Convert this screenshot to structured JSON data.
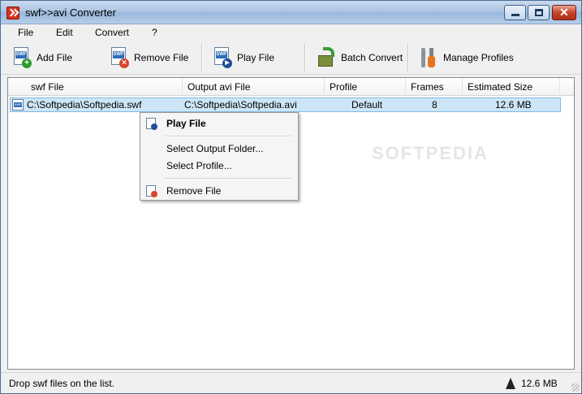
{
  "window": {
    "title": "swf>>avi Converter"
  },
  "menu": [
    "File",
    "Edit",
    "Convert",
    "?"
  ],
  "toolbar": {
    "add_file": "Add File",
    "remove_file": "Remove File",
    "play_file": "Play File",
    "batch_convert": "Batch Convert",
    "manage_profiles": "Manage Profiles"
  },
  "list": {
    "columns": [
      "swf File",
      "Output avi File",
      "Profile",
      "Frames",
      "Estimated Size"
    ],
    "rows": [
      {
        "swf_file": "C:\\Softpedia\\Softpedia.swf",
        "output": "C:\\Softpedia\\Softpedia.avi",
        "profile": "Default",
        "frames": "8",
        "size": "12.6 MB"
      }
    ]
  },
  "watermark": "SOFTPEDIA",
  "context_menu": {
    "play_file": "Play File",
    "select_output_folder": "Select Output Folder...",
    "select_profile": "Select Profile...",
    "remove_file": "Remove File"
  },
  "status": {
    "message": "Drop swf files on the list.",
    "total_size": "12.6 MB"
  }
}
